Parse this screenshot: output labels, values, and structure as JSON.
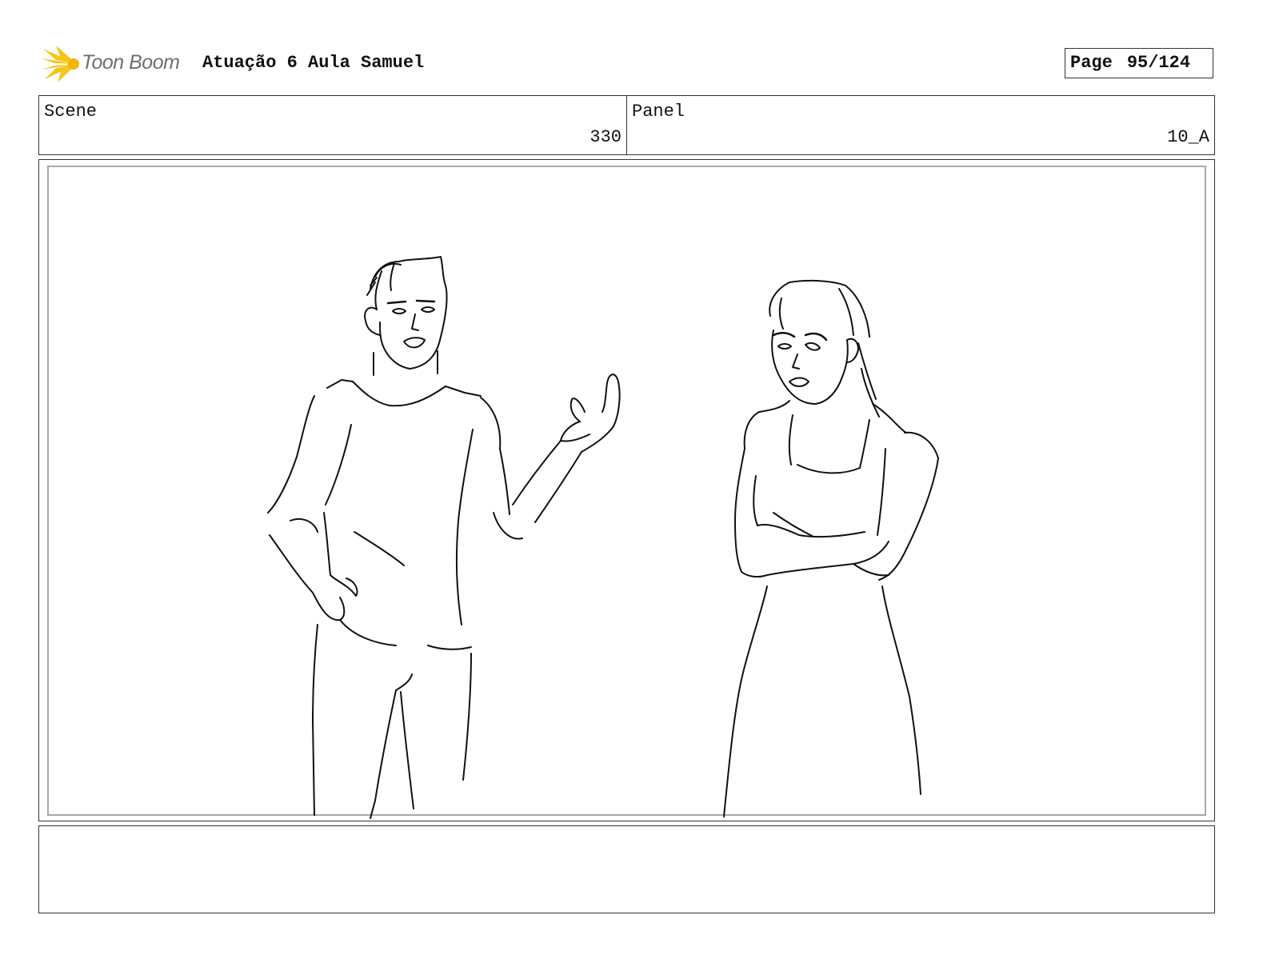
{
  "header": {
    "logo_text": "Toon Boom",
    "project_title": "Atuação 6 Aula Samuel",
    "page_label": "Page",
    "page_number": "95/124"
  },
  "info": {
    "scene_label": "Scene",
    "scene_value": "330",
    "panel_label": "Panel",
    "panel_value": "10_A"
  },
  "panel": {
    "drawing_icon": "storyboard-sketch",
    "caption": ""
  },
  "colors": {
    "logo_burst": "#f5c518",
    "logo_text": "#6f6f6f",
    "line": "#111111",
    "inner_frame": "#a8a8a8"
  }
}
